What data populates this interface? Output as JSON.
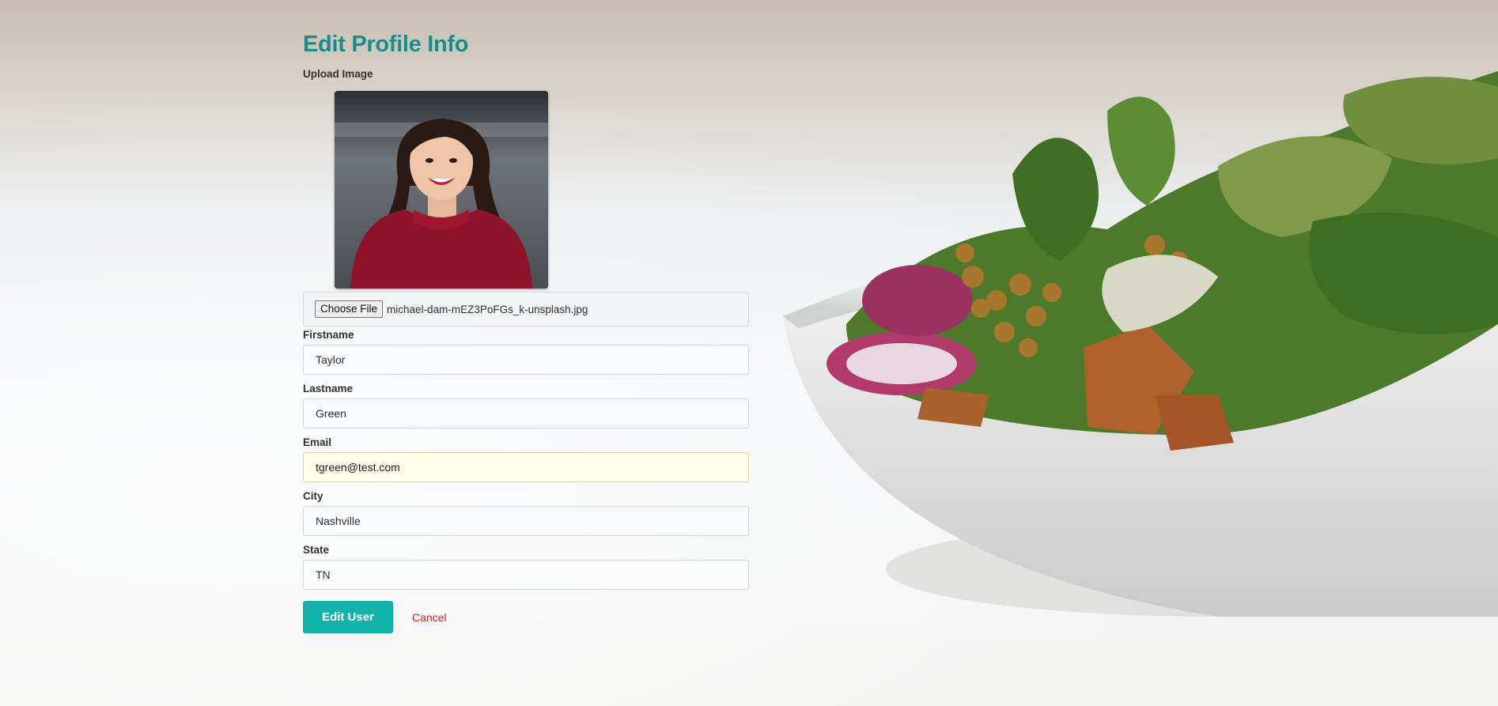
{
  "page": {
    "title": "Edit Profile Info"
  },
  "upload": {
    "label": "Upload Image",
    "choose_button": "Choose File",
    "file_name": "michael-dam-mEZ3PoFGs_k-unsplash.jpg"
  },
  "fields": {
    "firstname": {
      "label": "Firstname",
      "value": "Taylor"
    },
    "lastname": {
      "label": "Lastname",
      "value": "Green"
    },
    "email": {
      "label": "Email",
      "value": "tgreen@test.com"
    },
    "city": {
      "label": "City",
      "value": "Nashville"
    },
    "state": {
      "label": "State",
      "value": "TN"
    }
  },
  "actions": {
    "submit_label": "Edit User",
    "cancel_label": "Cancel"
  },
  "colors": {
    "title": "#1a8c8a",
    "primary_button": "#13b3aa",
    "cancel_link": "#e02020",
    "autofill_bg": "#fefee9"
  },
  "icons": {
    "profile_photo": "woman-portrait-photo",
    "background": "salad-bowl-photo"
  }
}
